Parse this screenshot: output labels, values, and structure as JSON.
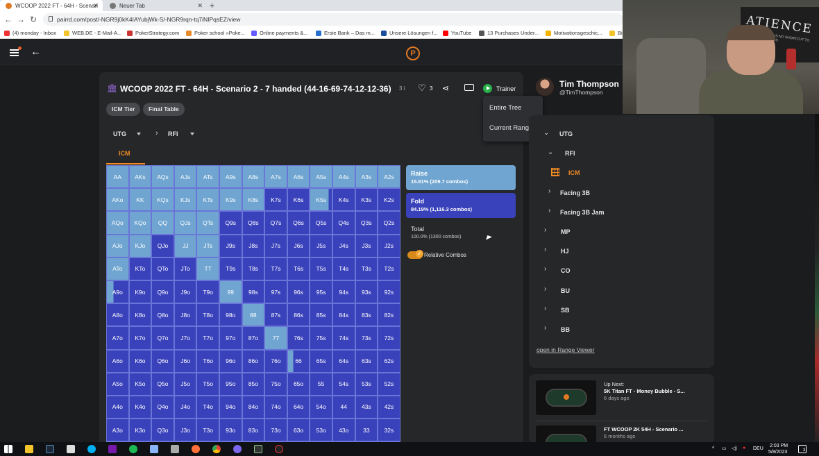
{
  "browser": {
    "tabs": [
      {
        "label": "WCOOP 2022 FT - 64H - Scenari"
      },
      {
        "label": "Neuer Tab"
      }
    ],
    "url": "pairrd.com/post/-NGR9j0kK4IAYubjWk-S/-NGR9rqn-tq7iNIPqsEZ/view",
    "bookmarks": [
      "(4) monday - Inbox",
      "WEB.DE - E-Mail-A...",
      "PokerStrategy.com",
      "Poker school »Poke...",
      "Online payments &...",
      "Erste Bank – Das m...",
      "Unsere Lösungen f...",
      "YouTube",
      "13 Purchases Under...",
      "Motivationsgeschic...",
      "Bi"
    ]
  },
  "header": {
    "logo": "P"
  },
  "post": {
    "title": "WCOOP 2022 FT - 64H - Scenario 2 - 7 handed (44-16-69-74-12-12-36)",
    "title_suffix": "3 i",
    "like_count": "3",
    "trainer_label": "Trainer",
    "tags": [
      "ICM Tier",
      "Final Table"
    ],
    "breadcrumb": {
      "position": "UTG",
      "node": "RFI"
    },
    "tab": "ICM"
  },
  "trainer_menu": {
    "items": [
      "Entire Tree",
      "Current Range"
    ]
  },
  "legend": {
    "raise": {
      "name": "Raise",
      "sub": "15.81% (209.7 combos)"
    },
    "fold": {
      "name": "Fold",
      "sub": "84.19% (1,116.3 combos)"
    },
    "total": {
      "name": "Total",
      "sub": "100.0% (1300 combos)"
    },
    "relative_combos": "Relative Combos",
    "colors": {
      "raise": "#6fa5d0",
      "fold": "#3a42bb"
    }
  },
  "grid": {
    "rows": [
      [
        "AA",
        "AKs",
        "AQs",
        "AJs",
        "ATs",
        "A9s",
        "A8s",
        "A7s",
        "A6s",
        "A5s",
        "A4s",
        "A3s",
        "A2s"
      ],
      [
        "AKo",
        "KK",
        "KQs",
        "KJs",
        "KTs",
        "K9s",
        "K8s",
        "K7s",
        "K6s",
        "K5s",
        "K4s",
        "K3s",
        "K2s"
      ],
      [
        "AQo",
        "KQo",
        "QQ",
        "QJs",
        "QTs",
        "Q9s",
        "Q8s",
        "Q7s",
        "Q6s",
        "Q5s",
        "Q4s",
        "Q3s",
        "Q2s"
      ],
      [
        "AJo",
        "KJo",
        "QJo",
        "JJ",
        "JTs",
        "J9s",
        "J8s",
        "J7s",
        "J6s",
        "J5s",
        "J4s",
        "J3s",
        "J2s"
      ],
      [
        "ATo",
        "KTo",
        "QTo",
        "JTo",
        "TT",
        "T9s",
        "T8s",
        "T7s",
        "T6s",
        "T5s",
        "T4s",
        "T3s",
        "T2s"
      ],
      [
        "A9o",
        "K9o",
        "Q9o",
        "J9o",
        "T9o",
        "99",
        "98s",
        "97s",
        "96s",
        "95s",
        "94s",
        "93s",
        "92s"
      ],
      [
        "A8o",
        "K8o",
        "Q8o",
        "J8o",
        "T8o",
        "98o",
        "88",
        "87s",
        "86s",
        "85s",
        "84s",
        "83s",
        "82s"
      ],
      [
        "A7o",
        "K7o",
        "Q7o",
        "J7o",
        "T7o",
        "97o",
        "87o",
        "77",
        "76s",
        "75s",
        "74s",
        "73s",
        "72s"
      ],
      [
        "A6o",
        "K6o",
        "Q6o",
        "J6o",
        "T6o",
        "96o",
        "86o",
        "76o",
        "66",
        "65s",
        "64s",
        "63s",
        "62s"
      ],
      [
        "A5o",
        "K5o",
        "Q5o",
        "J5o",
        "T5o",
        "95o",
        "85o",
        "75o",
        "65o",
        "55",
        "54s",
        "53s",
        "52s"
      ],
      [
        "A4o",
        "K4o",
        "Q4o",
        "J4o",
        "T4o",
        "94o",
        "84o",
        "74o",
        "64o",
        "54o",
        "44",
        "43s",
        "42s"
      ],
      [
        "A3o",
        "K3o",
        "Q3o",
        "J3o",
        "T3o",
        "93o",
        "83o",
        "73o",
        "63o",
        "53o",
        "43o",
        "33",
        "32s"
      ],
      [
        "A2o",
        "K2o",
        "Q2o",
        "J2o",
        "T2o",
        "92o",
        "82o",
        "72o",
        "62o",
        "52o",
        "42o",
        "32o",
        "22"
      ]
    ],
    "raise_fraction": [
      [
        1,
        1,
        1,
        1,
        1,
        1,
        1,
        1,
        1,
        1,
        1,
        1,
        1
      ],
      [
        1,
        1,
        1,
        1,
        1,
        1,
        1,
        0,
        0,
        0.85,
        0,
        0,
        0
      ],
      [
        1,
        1,
        1,
        1,
        1,
        0,
        0,
        0,
        0,
        0,
        0,
        0,
        0
      ],
      [
        1,
        1,
        0,
        1,
        1,
        0,
        0,
        0,
        0,
        0,
        0,
        0,
        0
      ],
      [
        1,
        0,
        0,
        0,
        1,
        0,
        0,
        0,
        0,
        0,
        0,
        0,
        0
      ],
      [
        0.3,
        0,
        0,
        0,
        0,
        1,
        0,
        0,
        0,
        0,
        0,
        0,
        0
      ],
      [
        0,
        0,
        0,
        0,
        0,
        0,
        1,
        0,
        0,
        0,
        0,
        0,
        0
      ],
      [
        0,
        0,
        0,
        0,
        0,
        0,
        0,
        1,
        0,
        0,
        0,
        0,
        0
      ],
      [
        0,
        0,
        0,
        0,
        0,
        0,
        0,
        0,
        0.25,
        0,
        0,
        0,
        0
      ],
      [
        0,
        0,
        0,
        0,
        0,
        0,
        0,
        0,
        0,
        0,
        0,
        0,
        0
      ],
      [
        0,
        0,
        0,
        0,
        0,
        0,
        0,
        0,
        0,
        0,
        0,
        0,
        0
      ],
      [
        0,
        0,
        0,
        0,
        0,
        0,
        0,
        0,
        0,
        0,
        0,
        0,
        0
      ],
      [
        0,
        0,
        0,
        0,
        0,
        0,
        0,
        0,
        0,
        0,
        0,
        0,
        0
      ]
    ]
  },
  "author": {
    "name": "Tim Thompson",
    "handle": "@TimThompson"
  },
  "tree": {
    "utg": "UTG",
    "rfi": "RFI",
    "icm": "ICM",
    "facing_3b": "Facing 3B",
    "facing_3b_jam": "Facing 3B Jam",
    "positions": [
      "MP",
      "HJ",
      "CO",
      "BU",
      "SB",
      "BB"
    ],
    "open_viewer": "open in Range Viewer"
  },
  "up_next": {
    "label": "Up Next:",
    "items": [
      {
        "title": "5K Titan FT - Money Bubble - S...",
        "age": "6 days ago"
      },
      {
        "title": "FT WCOOP 2K 54H - Scenario ...",
        "age": "6 months ago"
      }
    ]
  },
  "webcam": {
    "sign_text": "ATIENCE",
    "sign_sub": "THERE IS NO SHORTCUT TO SUCCESS"
  },
  "taskbar": {
    "lang": "DEU",
    "time": "2:03 PM",
    "date": "5/8/2023",
    "notif_count": "3"
  }
}
